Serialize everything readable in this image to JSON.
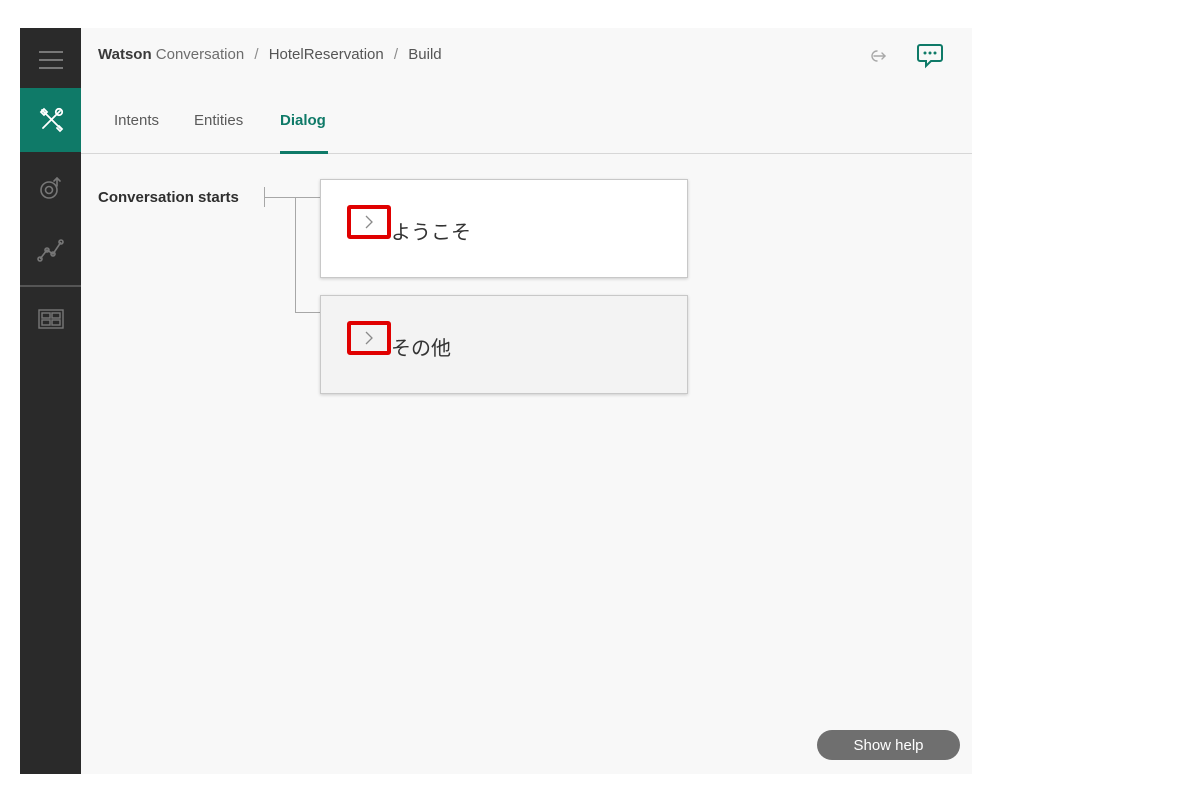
{
  "header": {
    "brand": "Watson",
    "product": "Conversation",
    "separator": "/",
    "workspace": "HotelReservation",
    "section": "Build",
    "icons": {
      "exit": "exit-arrow-icon",
      "chat": "chat-bubble-icon"
    }
  },
  "rail": {
    "items": [
      {
        "icon": "hamburger-menu-icon",
        "active": false
      },
      {
        "icon": "build-tools-icon",
        "active": true
      },
      {
        "icon": "deploy-icon",
        "active": false
      },
      {
        "icon": "improve-analytics-icon",
        "active": false
      },
      {
        "icon": "workspaces-grid-icon",
        "active": false
      }
    ]
  },
  "tabs": [
    {
      "label": "Intents",
      "active": false
    },
    {
      "label": "Entities",
      "active": false
    },
    {
      "label": "Dialog",
      "active": true
    }
  ],
  "dialog": {
    "start_label": "Conversation starts",
    "nodes": [
      {
        "title": "ようこそ",
        "expand_icon": "chevron-right-icon",
        "highlighted": true
      },
      {
        "title": "その他",
        "expand_icon": "chevron-right-icon",
        "highlighted": true
      }
    ]
  },
  "help": {
    "label": "Show help"
  },
  "colors": {
    "accent": "#0f7a68",
    "rail": "#2a2a2a",
    "canvas": "#f8f8f8",
    "highlight": "#e00000"
  }
}
